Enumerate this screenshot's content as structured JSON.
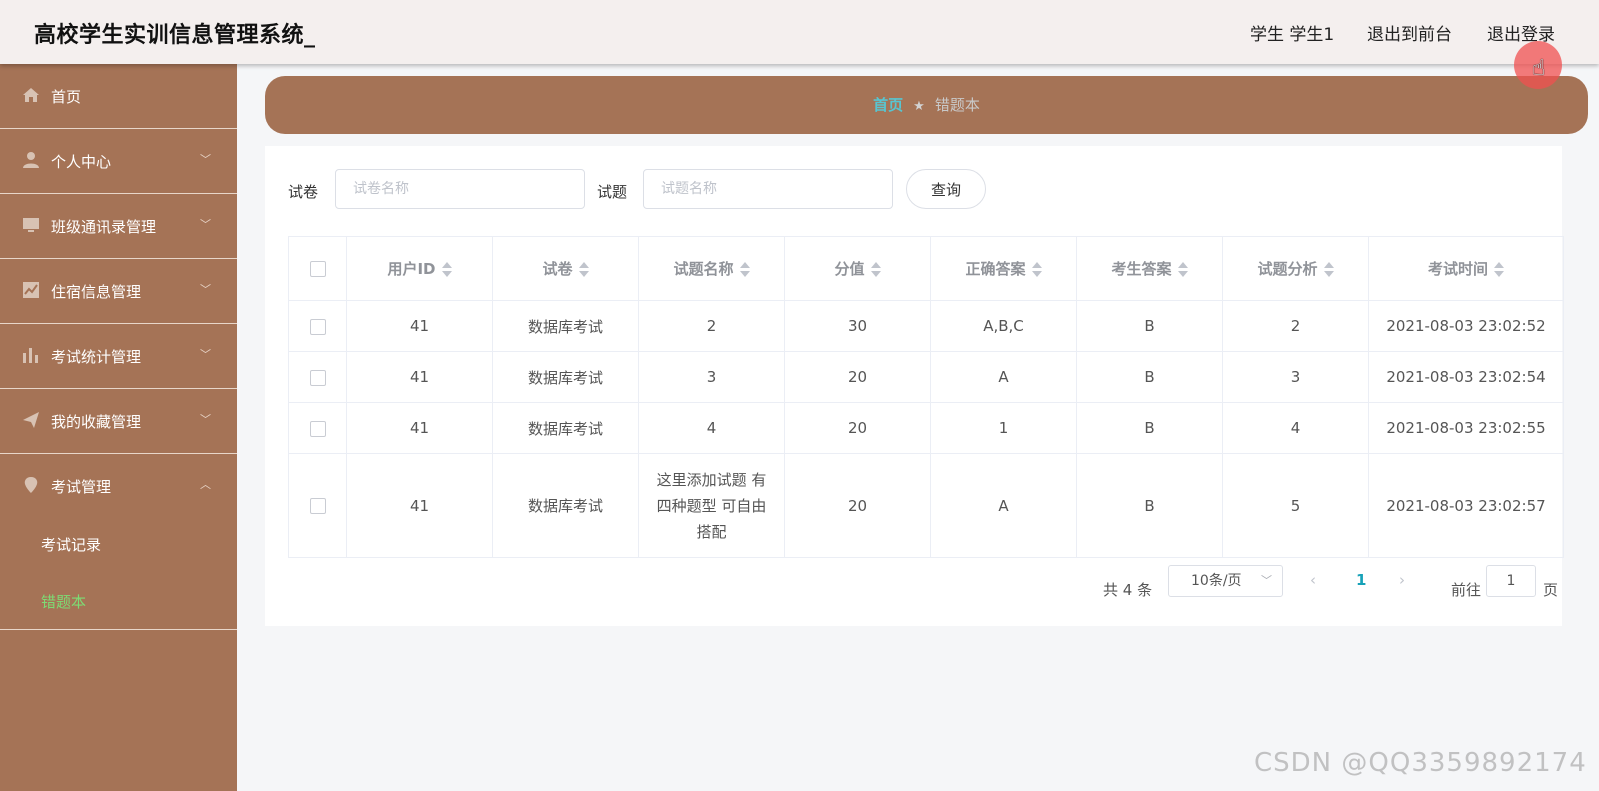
{
  "header": {
    "title": "高校学生实训信息管理系统_",
    "user": "学生 学生1",
    "nav_front": "退出到前台",
    "nav_logout": "退出登录"
  },
  "sidebar": {
    "items": [
      {
        "label": "首页",
        "icon": "home-icon"
      },
      {
        "label": "个人中心",
        "icon": "user-icon",
        "arrow": "﹀"
      },
      {
        "label": "班级通讯录管理",
        "icon": "monitor-icon",
        "arrow": "﹀"
      },
      {
        "label": "住宿信息管理",
        "icon": "chart-icon",
        "arrow": "﹀"
      },
      {
        "label": "考试统计管理",
        "icon": "bar-chart-icon",
        "arrow": "﹀"
      },
      {
        "label": "我的收藏管理",
        "icon": "send-icon",
        "arrow": "﹀"
      },
      {
        "label": "考试管理",
        "icon": "location-icon",
        "arrow": "︿"
      }
    ],
    "sub_items": [
      {
        "label": "考试记录",
        "active": false
      },
      {
        "label": "错题本",
        "active": true
      }
    ],
    "active_color": "#7ddc74"
  },
  "breadcrumb": {
    "home": "首页",
    "separator": "★",
    "current": "错题本"
  },
  "search": {
    "paper_label": "试卷",
    "paper_placeholder": "试卷名称",
    "question_label": "试题",
    "question_placeholder": "试题名称",
    "query_button": "查询"
  },
  "table": {
    "columns": [
      "用户ID",
      "试卷",
      "试题名称",
      "分值",
      "正确答案",
      "考生答案",
      "试题分析",
      "考试时间"
    ],
    "rows": [
      [
        "41",
        "数据库考试",
        "2",
        "30",
        "A,B,C",
        "B",
        "2",
        "2021-08-03 23:02:52"
      ],
      [
        "41",
        "数据库考试",
        "3",
        "20",
        "A",
        "B",
        "3",
        "2021-08-03 23:02:54"
      ],
      [
        "41",
        "数据库考试",
        "4",
        "20",
        "1",
        "B",
        "4",
        "2021-08-03 23:02:55"
      ],
      [
        "41",
        "数据库考试",
        "这里添加试题 有四种题型 可自由搭配",
        "20",
        "A",
        "B",
        "5",
        "2021-08-03 23:02:57"
      ]
    ]
  },
  "pagination": {
    "total": "共 4 条",
    "page_size": "10条/页",
    "prev": "‹",
    "current_page": "1",
    "next": "›",
    "goto_prefix": "前往",
    "goto_value": "1",
    "goto_suffix": "页"
  },
  "watermark": "CSDN @QQ3359892174",
  "colors": {
    "sidebar_bg": "#a57356",
    "header_bg": "#f4efee",
    "breadcrumb_home": "#58c5d0",
    "pagination_active": "#17a2b8"
  }
}
